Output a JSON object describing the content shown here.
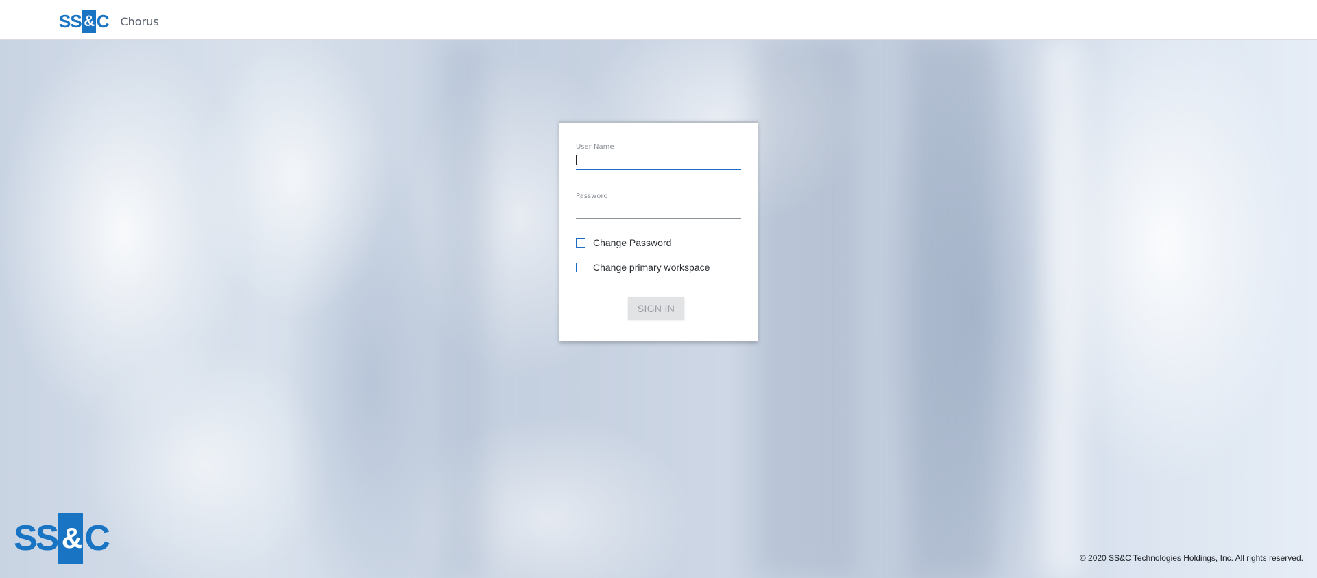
{
  "header": {
    "logo_left": "SS",
    "logo_box": "&",
    "logo_right": "C",
    "product": "Chorus"
  },
  "login": {
    "username_label": "User Name",
    "username_value": "",
    "password_label": "Password",
    "password_value": "",
    "change_password_label": "Change Password",
    "change_password_checked": false,
    "change_workspace_label": "Change primary workspace",
    "change_workspace_checked": false,
    "signin_label": "SIGN IN"
  },
  "footer": {
    "logo_left": "SS",
    "logo_box": "&",
    "logo_right": "C",
    "copyright": "© 2020 SS&C Technologies Holdings, Inc. All rights reserved."
  },
  "colors": {
    "brand_blue": "#1a74c4",
    "focus_blue": "#1b6ec2",
    "button_disabled_bg": "#e2e3e5"
  }
}
